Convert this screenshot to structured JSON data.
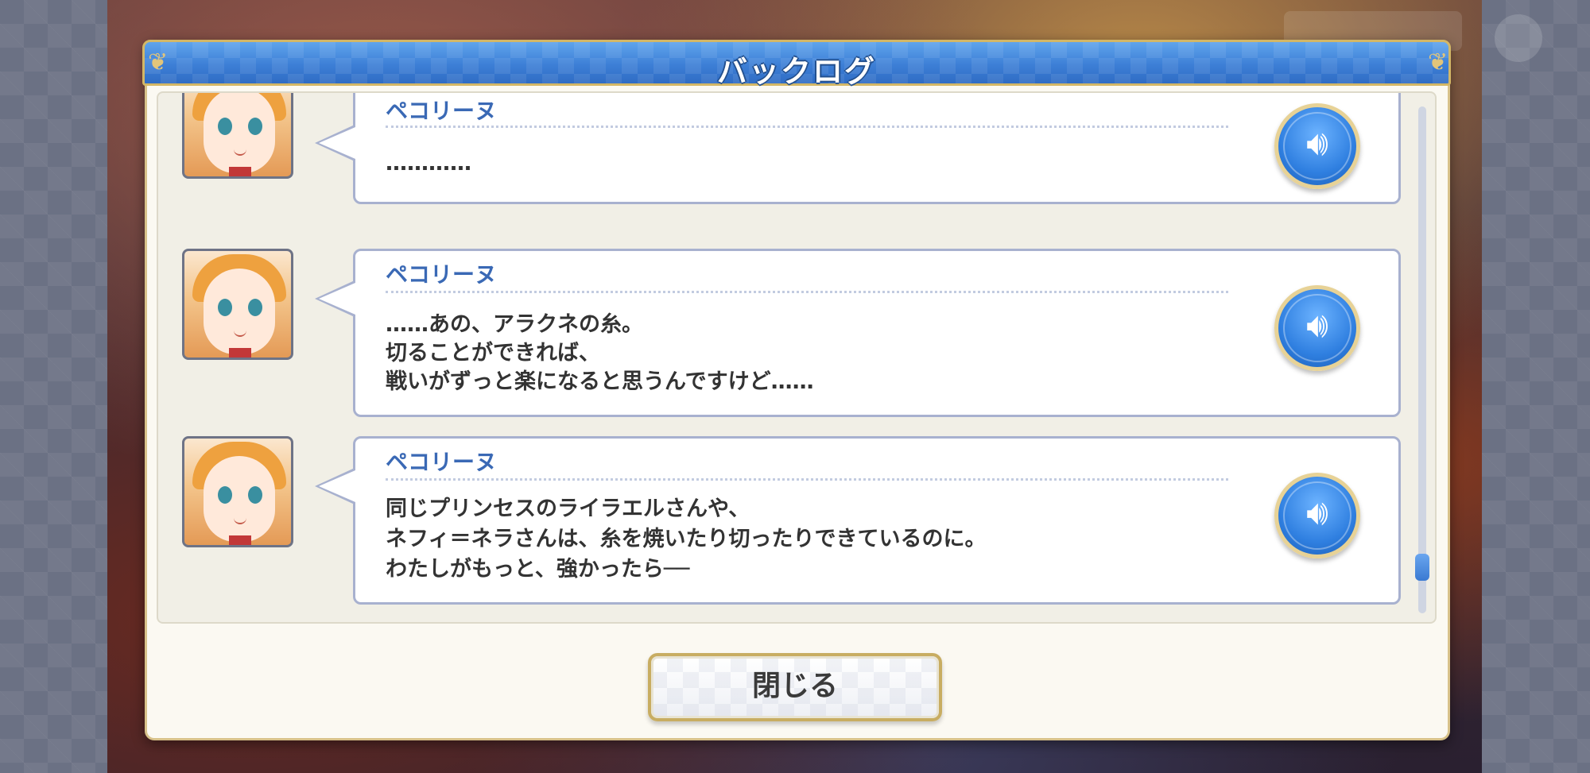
{
  "title": "バックログ",
  "entries": [
    {
      "speaker": "ペコリーヌ",
      "lines": [
        "…………"
      ]
    },
    {
      "speaker": "ペコリーヌ",
      "lines": [
        "……あの、アラクネの糸。",
        "切ることができれば、",
        "戦いがずっと楽になると思うんですけど……"
      ]
    },
    {
      "speaker": "ペコリーヌ",
      "lines": [
        "同じプリンセスのライラエルさんや、",
        "ネフィ＝ネラさんは、糸を焼いたり切ったりできているのに。",
        "わたしがもっと、強かったら──"
      ]
    }
  ],
  "voice_icon": "speaker-volume-icon",
  "close_button": "閉じる",
  "colors": {
    "header_blue": "#3d7fd6",
    "gold_border": "#d3b766",
    "speaker_name": "#3a69b5",
    "panel_bg": "#fbf9f2"
  }
}
